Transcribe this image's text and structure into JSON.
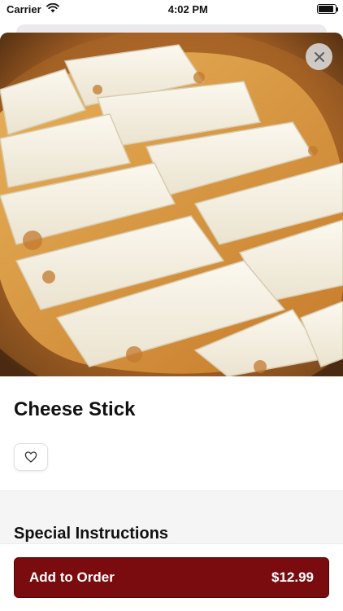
{
  "status_bar": {
    "carrier": "Carrier",
    "time": "4:02 PM",
    "icons": [
      "wifi-icon",
      "battery-icon"
    ]
  },
  "item": {
    "name": "Cheese Stick",
    "image_alt": "cheese-stick-photo",
    "price": "$12.99"
  },
  "sections": {
    "special_instructions_title": "Special Instructions"
  },
  "actions": {
    "add_to_order_label": "Add to Order",
    "close_icon": "close-icon",
    "favorite_icon": "heart-icon"
  },
  "colors": {
    "accent": "#7a0c0f",
    "surface": "#ffffff",
    "section_bg": "#f5f5f5"
  }
}
